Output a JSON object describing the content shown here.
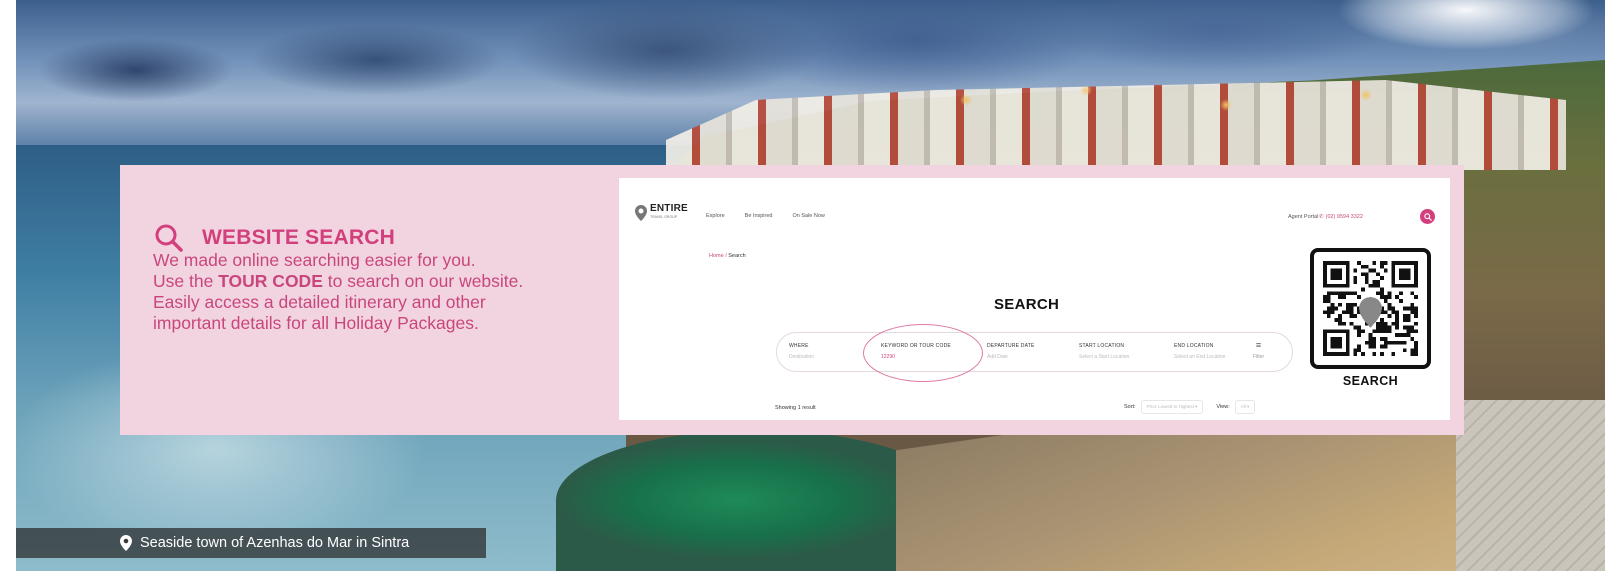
{
  "panel": {
    "title": "WEBSITE SEARCH",
    "line1": "We made online searching easier for you.",
    "line2_prefix": "Use the ",
    "line2_strong": "TOUR CODE",
    "line2_suffix": " to search on our website.",
    "line3": "Easily access a detailed itinerary and other",
    "line4": "important details for all Holiday Packages.",
    "accent_color": "#d23f7c",
    "background_color": "#f2d4e0",
    "icon": "search-icon"
  },
  "website": {
    "logo_main": "ENTIRE",
    "logo_sub": "TRAVEL GROUP",
    "nav": [
      "Explore",
      "Be Inspired",
      "On Sale Now"
    ],
    "agent_portal": "Agent Portal",
    "phone": "(02) 9594 3322",
    "breadcrumb_home": "Home",
    "breadcrumb_sep": " / ",
    "breadcrumb_current": "Search",
    "heading": "SEARCH",
    "search_fields": [
      {
        "label": "WHERE",
        "value": "Destination"
      },
      {
        "label": "KEYWORD OR TOUR CODE",
        "value": "12290"
      },
      {
        "label": "DEPARTURE DATE",
        "value": "Add Date"
      },
      {
        "label": "START LOCATION",
        "value": "Select a Start Location"
      },
      {
        "label": "END LOCATION",
        "value": "Select an End Location"
      }
    ],
    "filter_label": "Filter",
    "filter_icon": "≡",
    "results_text": "Showing 1 result",
    "sort_label": "Sort:",
    "sort_value": "Price Lowest to Highest ▾",
    "view_label": "View:",
    "view_value": "All ▾"
  },
  "qr": {
    "label": "SEARCH"
  },
  "caption": {
    "text": "Seaside town of Azenhas do Mar in Sintra",
    "icon": "map-pin-icon"
  }
}
